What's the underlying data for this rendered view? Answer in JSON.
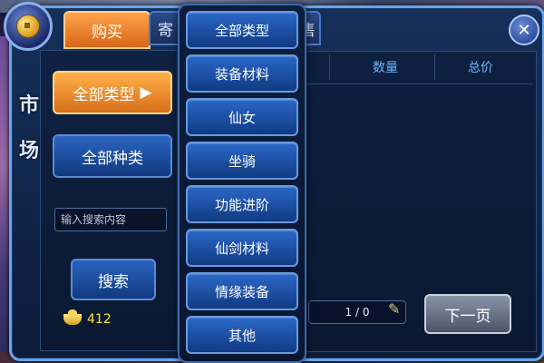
{
  "tabs": {
    "buy": "购买",
    "consign": "寄",
    "hidden_right": "售"
  },
  "close_icon": "close-icon",
  "side_title": [
    "市",
    "场"
  ],
  "left_panel": {
    "all_types_button": "全部类型",
    "all_kinds_button": "全部种类",
    "search_placeholder": "输入搜索内容",
    "search_button": "搜索",
    "gold_amount": "412"
  },
  "table": {
    "columns": [
      "数量",
      "总价"
    ]
  },
  "pagination": {
    "page_text": "1 / 0",
    "next_button": "下一页"
  },
  "dropdown": {
    "items": [
      "全部类型",
      "装备材料",
      "仙女",
      "坐骑",
      "功能进阶",
      "仙剑材料",
      "情缘装备",
      "其他"
    ]
  },
  "colors": {
    "accent_orange": "#f08a2a",
    "accent_blue": "#2a64c0",
    "gold": "#ffe23a"
  }
}
